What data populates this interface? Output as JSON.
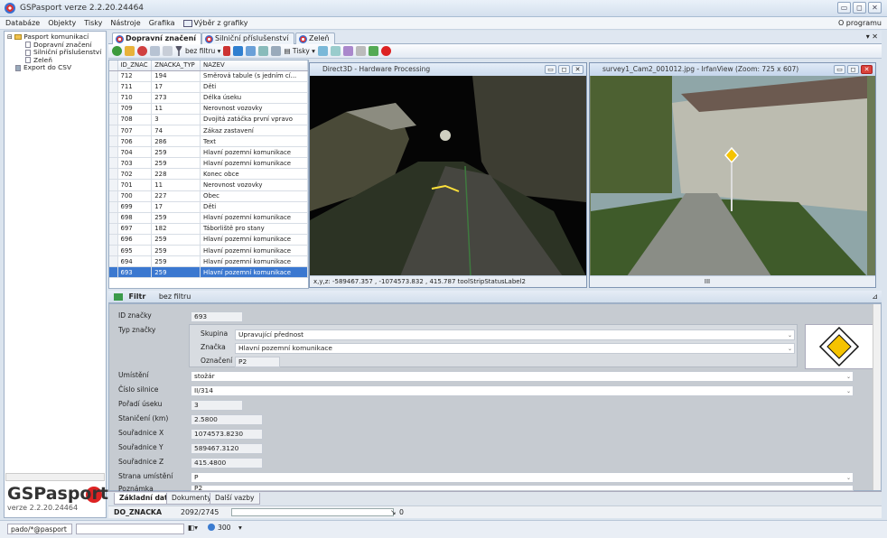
{
  "app": {
    "title": "GSPasport  verze 2.2.20.24464"
  },
  "window_buttons": {
    "minimize": "▭",
    "maximize": "◻",
    "close": "✕"
  },
  "menu": {
    "items": [
      "Databáze",
      "Objekty",
      "Tisky",
      "Nástroje",
      "Grafika",
      "Výběr z grafiky"
    ],
    "right": "O programu"
  },
  "tree": {
    "items": [
      {
        "label": "Pasport komunikací",
        "level": 0,
        "icon": "folder-icon"
      },
      {
        "label": "Dopravní značení",
        "level": 1,
        "icon": "document-icon"
      },
      {
        "label": "Silniční příslušenství",
        "level": 1,
        "icon": "document-icon"
      },
      {
        "label": "Zeleň",
        "level": 1,
        "icon": "document-icon"
      },
      {
        "label": "Export do CSV",
        "level": 0,
        "icon": "export-icon"
      }
    ]
  },
  "logo": {
    "name": "GSPasport",
    "version": "verze 2.2.20.24464"
  },
  "tabs": [
    {
      "label": "Dopravní značení",
      "active": true
    },
    {
      "label": "Silniční příslušenství",
      "active": false
    },
    {
      "label": "Zeleň",
      "active": false
    }
  ],
  "tab_close": "▾ ✕",
  "toolbar": {
    "filter_label": "bez filtru",
    "print_label": "Tisky"
  },
  "grid": {
    "columns": [
      "ID_ZNAC",
      "ZNACKA_TYP",
      "NAZEV"
    ],
    "rows": [
      [
        "712",
        "194",
        "Směrová tabule (s jedním cí..."
      ],
      [
        "711",
        "17",
        "Děti"
      ],
      [
        "710",
        "273",
        "Délka úseku"
      ],
      [
        "709",
        "11",
        "Nerovnost vozovky"
      ],
      [
        "708",
        "3",
        "Dvojitá zatáčka první vpravo"
      ],
      [
        "707",
        "74",
        "Zákaz zastavení"
      ],
      [
        "706",
        "286",
        "Text"
      ],
      [
        "704",
        "259",
        "Hlavní pozemní komunikace"
      ],
      [
        "703",
        "259",
        "Hlavní pozemní komunikace"
      ],
      [
        "702",
        "228",
        "Konec obce"
      ],
      [
        "701",
        "11",
        "Nerovnost vozovky"
      ],
      [
        "700",
        "227",
        "Obec"
      ],
      [
        "699",
        "17",
        "Děti"
      ],
      [
        "698",
        "259",
        "Hlavní pozemní komunikace"
      ],
      [
        "697",
        "182",
        "Táborliště pro stany"
      ],
      [
        "696",
        "259",
        "Hlavní pozemní komunikace"
      ],
      [
        "695",
        "259",
        "Hlavní pozemní komunikace"
      ],
      [
        "694",
        "259",
        "Hlavní pozemní komunikace"
      ],
      [
        "693",
        "259",
        "Hlavní pozemní komunikace"
      ]
    ],
    "selected_index": 18
  },
  "direct3d": {
    "title": "Direct3D - Hardware Processing",
    "status": "x,y,z: -589467.357 , -1074573.832 , 415.787  toolStripStatusLabel2"
  },
  "irfan": {
    "title": "survey1_Cam2_001012.jpg - IrfanView (Zoom: 725 x 607)",
    "scroll_label": "III"
  },
  "filter_bar": {
    "label": "Filtr",
    "value": "bez filtru"
  },
  "form": {
    "id_label": "ID značky",
    "id_value": "693",
    "typ_label": "Typ značky",
    "skupina_label": "Skupina",
    "skupina_value": "Upravující přednost",
    "znacka_label": "Značka",
    "znacka_value": "Hlavní pozemní komunikace",
    "oznaceni_label": "Označení",
    "oznaceni_value": "P2",
    "umisteni_label": "Umístění",
    "umisteni_value": "stožár",
    "cislo_label": "Číslo silnice",
    "cislo_value": "II/314",
    "poradi_label": "Pořadí úseku",
    "poradi_value": "3",
    "staniceni_label": "Staničení (km)",
    "staniceni_value": "2.5800",
    "sx_label": "Souřadnice X",
    "sx_value": "1074573.8230",
    "sy_label": "Souřadnice Y",
    "sy_value": "589467.3120",
    "sz_label": "Souřadnice Z",
    "sz_value": "415.4800",
    "strana_label": "Strana umístění",
    "strana_value": "P",
    "poznamka_label": "Poznámka",
    "poznamka_value": "P2"
  },
  "bottom_tabs": [
    {
      "label": "Základní data",
      "active": true
    },
    {
      "label": "Dokumenty",
      "active": false
    },
    {
      "label": "Další vazby",
      "active": false
    }
  ],
  "status_row": {
    "field": "DO_ZNACKA",
    "record": "2092/2745",
    "value": "0"
  },
  "statusbar": {
    "user": "pado/*@pasport",
    "zoom": "300"
  },
  "colors": {
    "accent": "#3b78d0",
    "sign_yellow": "#f5c300"
  }
}
